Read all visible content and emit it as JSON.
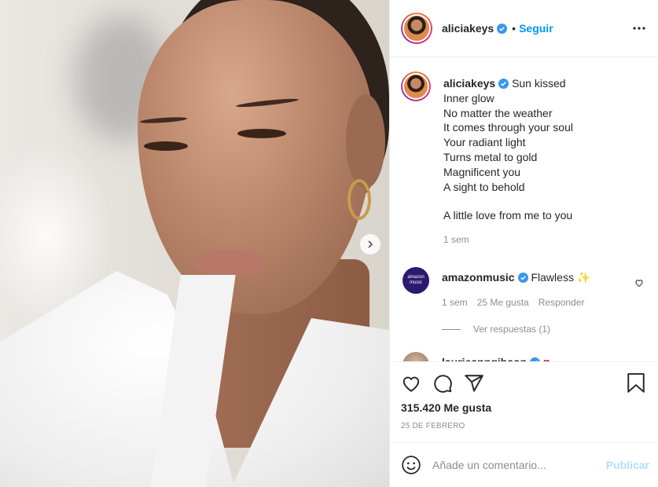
{
  "media": {
    "next_icon": "chevron-right-icon"
  },
  "header": {
    "username": "aliciakeys",
    "follow_label": "Seguir",
    "dot": "•",
    "more_icon": "more-horizontal-icon"
  },
  "caption": {
    "username": "aliciakeys",
    "lines": [
      "Sun kissed",
      "Inner glow",
      "No matter the weather",
      "It comes through your soul",
      "Your radiant light",
      "Turns metal to gold",
      "Magnificent you",
      "A sight to behold",
      "",
      "A little love from me to you"
    ],
    "time": "1 sem"
  },
  "comments": [
    {
      "username": "amazonmusic",
      "text": "Flawless",
      "emoji": "✨",
      "avatar_text": [
        "amazon",
        "music"
      ],
      "time": "1 sem",
      "likes": "25 Me gusta",
      "reply_label": "Responder",
      "view_replies": "Ver respuestas (1)"
    },
    {
      "username": "laurieanngibson",
      "emoji": "♥"
    }
  ],
  "actions": {
    "likes": "315.420 Me gusta",
    "date": "25 DE FEBRERO"
  },
  "add_comment": {
    "placeholder": "Añade un comentario...",
    "post_label": "Publicar"
  },
  "colors": {
    "link": "#0095f6",
    "verified": "#3897f0",
    "heart": "#ed4956",
    "post_disabled": "#b2dffc"
  }
}
